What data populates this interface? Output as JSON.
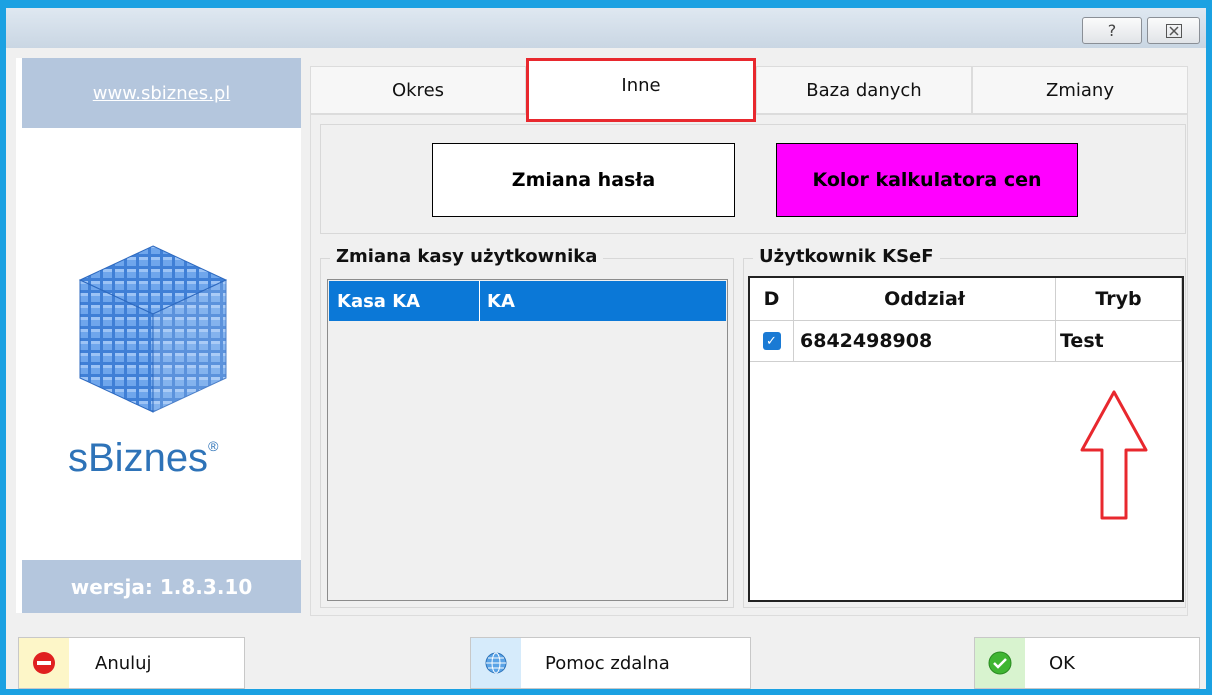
{
  "titlebar": {
    "help_label": "?",
    "close_label": "☒"
  },
  "sidebar": {
    "website": "www.sbiznes.pl",
    "brand": "sBiznes",
    "trademark": "®",
    "version": "wersja: 1.8.3.10"
  },
  "tabs": [
    {
      "label": "Okres"
    },
    {
      "label": "Inne"
    },
    {
      "label": "Baza danych"
    },
    {
      "label": "Zmiany"
    }
  ],
  "buttons": {
    "change_password": "Zmiana hasła",
    "price_calc_color": "Kolor kalkulatora cen",
    "price_calc_color_hex": "#ff00ff"
  },
  "cash_group": {
    "title": "Zmiana kasy użytkownika",
    "rows": [
      {
        "code": "Kasa KA",
        "value": "KA"
      }
    ]
  },
  "ksef_group": {
    "title": "Użytkownik KSeF",
    "columns": {
      "d": "D",
      "branch": "Oddział",
      "mode": "Tryb"
    },
    "rows": [
      {
        "checked": true,
        "branch": "6842498908",
        "mode": "Test"
      }
    ]
  },
  "footer": {
    "cancel": "Anuluj",
    "remote_help": "Pomoc zdalna",
    "ok": "OK"
  },
  "icons": {
    "cancel": "no-entry-icon",
    "remote": "globe-icon",
    "ok": "check-circle-icon",
    "annotation": "arrow-up-outline-icon"
  },
  "colors": {
    "accent": "#1ba1e2",
    "selection": "#0b78d7",
    "annotation": "#e8282e",
    "sidebar_panel": "#b4c6dd"
  }
}
